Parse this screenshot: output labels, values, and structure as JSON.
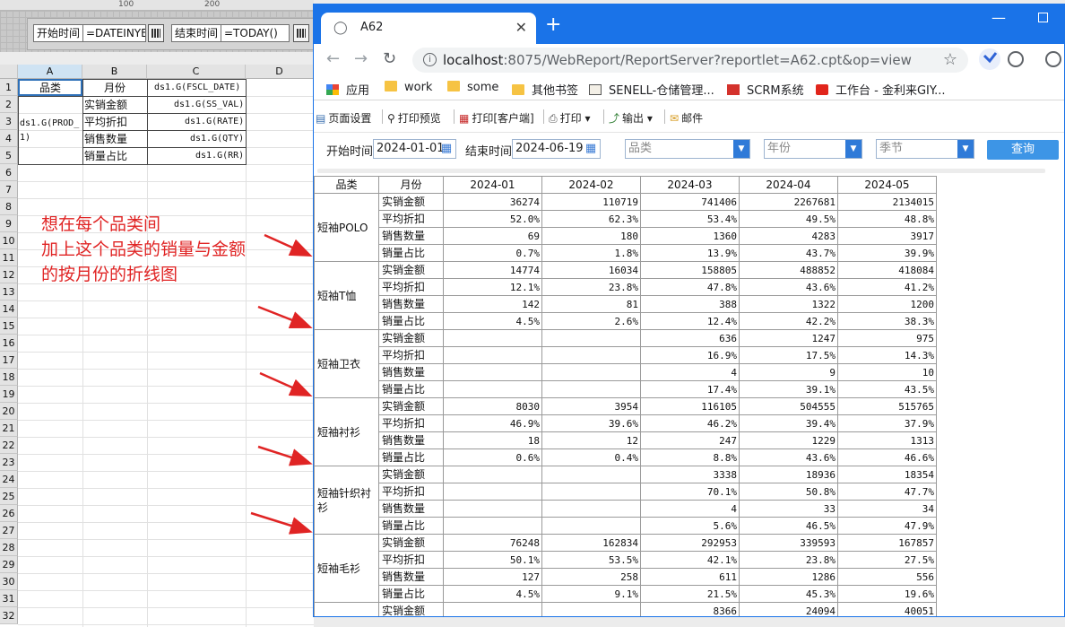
{
  "designer": {
    "ruler_ticks": [
      "100",
      "200"
    ],
    "params": {
      "start_label": "开始时间",
      "start_value": "=DATEINYE",
      "end_label": "结束时间",
      "end_value": "=TODAY()"
    },
    "columns": [
      "A",
      "B",
      "C",
      "D"
    ],
    "rows": [
      "1",
      "2",
      "3",
      "4",
      "5",
      "6",
      "7",
      "8",
      "9",
      "10",
      "11",
      "12",
      "13",
      "14",
      "15",
      "16",
      "17",
      "18",
      "19",
      "20",
      "21",
      "22",
      "23",
      "24",
      "25",
      "26",
      "27",
      "28",
      "29",
      "30",
      "31",
      "32"
    ],
    "cells": {
      "a1": "品类",
      "b1": "月份",
      "c1": "ds1.G(FSCL_DATE)",
      "a2": "ds1.G(PROD_\n1)",
      "b2": "实销金额",
      "b3": "平均折扣",
      "b4": "销售数量",
      "b5": "销量占比",
      "c2": "ds1.G(SS_VAL)",
      "c3": "ds1.G(RATE)",
      "c4": "ds1.G(QTY)",
      "c5": "ds1.G(RR)"
    },
    "annotation": [
      "想在每个品类间",
      "加上这个品类的销量与金额",
      "的按月份的折线图"
    ],
    "annotation_color": "#e02424"
  },
  "browser": {
    "tab_title": "A62",
    "url_host": "localhost",
    "url_rest": ":8075/WebReport/ReportServer?reportlet=A62.cpt&op=view",
    "accent": "#1a73e8",
    "bookmarks": [
      "应用",
      "work",
      "some",
      "其他书签",
      "SENELL-仓储管理...",
      "SCRM系统",
      "工作台 - 金利来GIY..."
    ],
    "bookmark_icons": [
      "apps-grid-icon",
      "folder-icon",
      "folder-icon",
      "folder-icon",
      "senell-icon",
      "sw-icon",
      "worktable-icon"
    ]
  },
  "toolbar": {
    "page_setup": "页面设置",
    "print_preview": "打印预览",
    "print_client": "打印[客户端]",
    "print": "打印",
    "export": "输出",
    "mail": "邮件"
  },
  "params": {
    "start_label": "开始时间",
    "start_value": "2024-01-01",
    "end_label": "结束时间",
    "end_value": "2024-06-19",
    "category_placeholder": "品类",
    "year_placeholder": "年份",
    "season_placeholder": "季节",
    "query_label": "查询",
    "query_color": "#3d95e6"
  },
  "report": {
    "headers": [
      "品类",
      "月份",
      "2024-01",
      "2024-02",
      "2024-03",
      "2024-04",
      "2024-05"
    ],
    "metrics": [
      "实销金额",
      "平均折扣",
      "销售数量",
      "销量占比"
    ],
    "groups": [
      {
        "name": "短袖POLO",
        "rows": [
          [
            "36274",
            "110719",
            "741406",
            "2267681",
            "2134015"
          ],
          [
            "52.0%",
            "62.3%",
            "53.4%",
            "49.5%",
            "48.8%"
          ],
          [
            "69",
            "180",
            "1360",
            "4283",
            "3917"
          ],
          [
            "0.7%",
            "1.8%",
            "13.9%",
            "43.7%",
            "39.9%"
          ]
        ]
      },
      {
        "name": "短袖T恤",
        "rows": [
          [
            "14774",
            "16034",
            "158805",
            "488852",
            "418084"
          ],
          [
            "12.1%",
            "23.8%",
            "47.8%",
            "43.6%",
            "41.2%"
          ],
          [
            "142",
            "81",
            "388",
            "1322",
            "1200"
          ],
          [
            "4.5%",
            "2.6%",
            "12.4%",
            "42.2%",
            "38.3%"
          ]
        ]
      },
      {
        "name": "短袖卫衣",
        "rows": [
          [
            "",
            "",
            "636",
            "1247",
            "975"
          ],
          [
            "",
            "",
            "16.9%",
            "17.5%",
            "14.3%"
          ],
          [
            "",
            "",
            "4",
            "9",
            "10"
          ],
          [
            "",
            "",
            "17.4%",
            "39.1%",
            "43.5%"
          ]
        ]
      },
      {
        "name": "短袖衬衫",
        "rows": [
          [
            "8030",
            "3954",
            "116105",
            "504555",
            "515765"
          ],
          [
            "46.9%",
            "39.6%",
            "46.2%",
            "39.4%",
            "37.9%"
          ],
          [
            "18",
            "12",
            "247",
            "1229",
            "1313"
          ],
          [
            "0.6%",
            "0.4%",
            "8.8%",
            "43.6%",
            "46.6%"
          ]
        ]
      },
      {
        "name": "短袖针织衬衫",
        "rows": [
          [
            "",
            "",
            "3338",
            "18936",
            "18354"
          ],
          [
            "",
            "",
            "70.1%",
            "50.8%",
            "47.7%"
          ],
          [
            "",
            "",
            "4",
            "33",
            "34"
          ],
          [
            "",
            "",
            "5.6%",
            "46.5%",
            "47.9%"
          ]
        ]
      },
      {
        "name": "短袖毛衫",
        "rows": [
          [
            "76248",
            "162834",
            "292953",
            "339593",
            "167857"
          ],
          [
            "50.1%",
            "53.5%",
            "42.1%",
            "23.8%",
            "27.5%"
          ],
          [
            "127",
            "258",
            "611",
            "1286",
            "556"
          ],
          [
            "4.5%",
            "9.1%",
            "21.5%",
            "45.3%",
            "19.6%"
          ]
        ]
      },
      {
        "name": "",
        "rows": [
          [
            "",
            "",
            "8366",
            "24094",
            "40051"
          ]
        ]
      }
    ]
  }
}
